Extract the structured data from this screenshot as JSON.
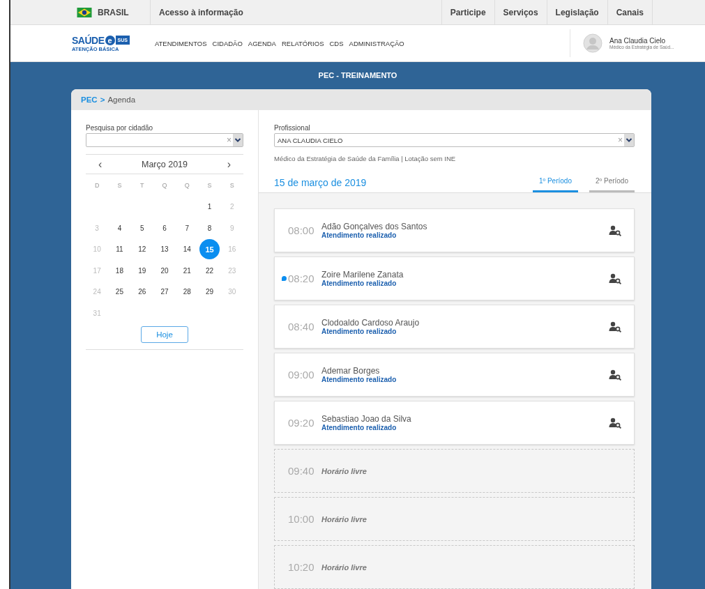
{
  "gov_bar": {
    "country": "BRASIL",
    "link": "Acesso à informação",
    "items": [
      "Participe",
      "Serviços",
      "Legislação",
      "Canais"
    ]
  },
  "header": {
    "logo": {
      "name": "SAÚDE",
      "letter": "e",
      "badge": "SUS",
      "subtitle": "ATENÇÃO BÁSICA"
    },
    "menu": [
      "ATENDIMENTOS",
      "CIDADÃO",
      "AGENDA",
      "RELATÓRIOS",
      "CDS",
      "ADMINISTRAÇÃO"
    ],
    "user": {
      "name": "Ana Claudia Cielo",
      "role": "Médico da Estratégia de Saúd..."
    }
  },
  "page_title": "PEC - TREINAMENTO",
  "breadcrumb": {
    "root": "PEC",
    "separator": ">",
    "current": "Agenda"
  },
  "citizen_search": {
    "label": "Pesquisa por cidadão",
    "clear": "×"
  },
  "calendar": {
    "month": "Março 2019",
    "prev": "‹",
    "next": "›",
    "weekdays": [
      "D",
      "S",
      "T",
      "Q",
      "Q",
      "S",
      "S"
    ],
    "weeks": [
      {
        "kind": "leading",
        "days": [
          {
            "label": "1",
            "muted": false,
            "selected": false
          },
          {
            "label": "2",
            "muted": true,
            "selected": false
          }
        ]
      },
      {
        "kind": "full",
        "days": [
          {
            "label": "3",
            "muted": true,
            "selected": false
          },
          {
            "label": "4",
            "muted": false,
            "selected": false
          },
          {
            "label": "5",
            "muted": false,
            "selected": false
          },
          {
            "label": "6",
            "muted": false,
            "selected": false
          },
          {
            "label": "7",
            "muted": false,
            "selected": false
          },
          {
            "label": "8",
            "muted": false,
            "selected": false
          },
          {
            "label": "9",
            "muted": true,
            "selected": false
          }
        ]
      },
      {
        "kind": "full",
        "days": [
          {
            "label": "10",
            "muted": true,
            "selected": false
          },
          {
            "label": "11",
            "muted": false,
            "selected": false
          },
          {
            "label": "12",
            "muted": false,
            "selected": false
          },
          {
            "label": "13",
            "muted": false,
            "selected": false
          },
          {
            "label": "14",
            "muted": false,
            "selected": false
          },
          {
            "label": "15",
            "muted": false,
            "selected": true
          },
          {
            "label": "16",
            "muted": true,
            "selected": false
          }
        ]
      },
      {
        "kind": "full",
        "days": [
          {
            "label": "17",
            "muted": true,
            "selected": false
          },
          {
            "label": "18",
            "muted": false,
            "selected": false
          },
          {
            "label": "19",
            "muted": false,
            "selected": false
          },
          {
            "label": "20",
            "muted": false,
            "selected": false
          },
          {
            "label": "21",
            "muted": false,
            "selected": false
          },
          {
            "label": "22",
            "muted": false,
            "selected": false
          },
          {
            "label": "23",
            "muted": true,
            "selected": false
          }
        ]
      },
      {
        "kind": "full",
        "days": [
          {
            "label": "24",
            "muted": true,
            "selected": false
          },
          {
            "label": "25",
            "muted": false,
            "selected": false
          },
          {
            "label": "26",
            "muted": false,
            "selected": false
          },
          {
            "label": "27",
            "muted": false,
            "selected": false
          },
          {
            "label": "28",
            "muted": false,
            "selected": false
          },
          {
            "label": "29",
            "muted": false,
            "selected": false
          },
          {
            "label": "30",
            "muted": true,
            "selected": false
          }
        ]
      },
      {
        "kind": "trailing",
        "days": [
          {
            "label": "31",
            "muted": true,
            "selected": false
          }
        ]
      }
    ],
    "today_button": "Hoje"
  },
  "professional": {
    "label": "Profissional",
    "value": "ANA CLAUDIA CIELO",
    "clear": "×",
    "info": "Médico da Estratégia de Saúde da Família | Lotação sem INE"
  },
  "date": "15 de março de 2019",
  "tabs": [
    {
      "label": "1º Período",
      "selected": true
    },
    {
      "label": "2º Período",
      "selected": false
    }
  ],
  "appointments": [
    {
      "kind": "booked",
      "time": "08:00",
      "name": "Adão Gonçalves dos Santos",
      "status": "Atendimento realizado",
      "marker": false
    },
    {
      "kind": "booked",
      "time": "08:20",
      "name": "Zoire Marilene Zanata",
      "status": "Atendimento realizado",
      "marker": true
    },
    {
      "kind": "booked",
      "time": "08:40",
      "name": "Clodoaldo Cardoso Araujo",
      "status": "Atendimento realizado",
      "marker": false
    },
    {
      "kind": "booked",
      "time": "09:00",
      "name": "Ademar Borges",
      "status": "Atendimento realizado",
      "marker": false
    },
    {
      "kind": "booked",
      "time": "09:20",
      "name": "Sebastiao Joao da Silva",
      "status": "Atendimento realizado",
      "marker": false
    },
    {
      "kind": "free",
      "time": "09:40",
      "label": "Horário livre"
    },
    {
      "kind": "free",
      "time": "10:00",
      "label": "Horário livre"
    },
    {
      "kind": "free",
      "time": "10:20",
      "label": "Horário livre"
    }
  ]
}
